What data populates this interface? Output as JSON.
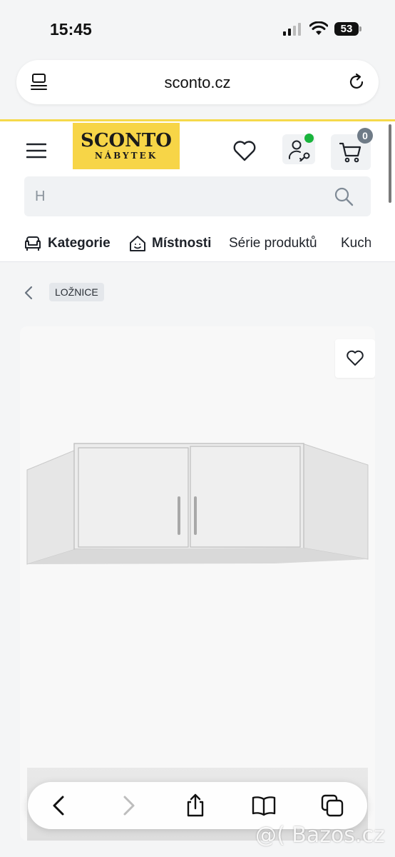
{
  "status_bar": {
    "time": "15:45",
    "battery": "53"
  },
  "browser": {
    "url": "sconto.cz"
  },
  "header": {
    "logo_main": "SCONTO",
    "logo_sub": "NÁBYTEK",
    "cart_count": "0",
    "search": {
      "value": "H"
    }
  },
  "nav": {
    "items": [
      {
        "label": "Kategorie",
        "icon": "armchair-icon"
      },
      {
        "label": "Místnosti",
        "icon": "house-icon"
      },
      {
        "label": "Série produktů"
      },
      {
        "label": "Kuch"
      }
    ]
  },
  "breadcrumb": {
    "category": "LOŽNICE"
  },
  "watermark": "@( Bazos.cz",
  "colors": {
    "brand_yellow": "#f7d547",
    "online_green": "#19b43c",
    "badge_gray": "#6f7b87"
  }
}
